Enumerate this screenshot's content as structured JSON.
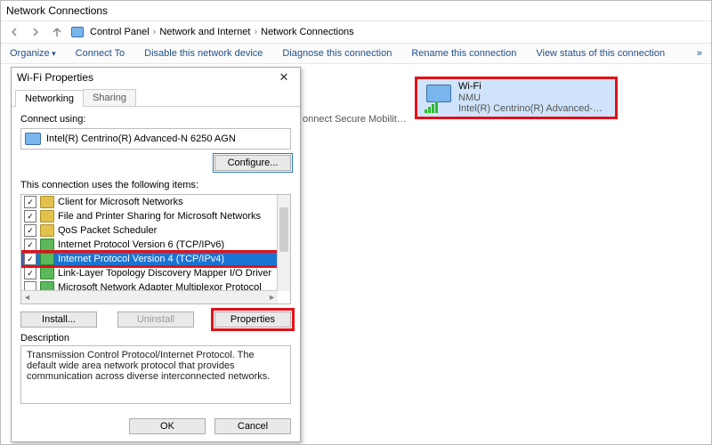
{
  "window": {
    "title": "Network Connections"
  },
  "breadcrumb": [
    "Control Panel",
    "Network and Internet",
    "Network Connections"
  ],
  "toolbar": {
    "organize": "Organize",
    "connect_to": "Connect To",
    "disable": "Disable this network device",
    "diagnose": "Diagnose this connection",
    "rename": "Rename this connection",
    "view_status": "View status of this connection",
    "overflow": "»"
  },
  "background_peek": "onnect Secure Mobilit…",
  "connection": {
    "name": "Wi-Fi",
    "ssid": "NMU",
    "adapter_short": "Intel(R) Centrino(R) Advanced-N ..."
  },
  "dialog": {
    "title": "Wi-Fi Properties",
    "tabs": [
      "Networking",
      "Sharing"
    ],
    "connect_using_label": "Connect using:",
    "adapter": "Intel(R) Centrino(R) Advanced-N 6250 AGN",
    "configure": "Configure...",
    "items_label": "This connection uses the following items:",
    "items": [
      {
        "label": "Client for Microsoft Networks",
        "checked": true
      },
      {
        "label": "File and Printer Sharing for Microsoft Networks",
        "checked": true
      },
      {
        "label": "QoS Packet Scheduler",
        "checked": true
      },
      {
        "label": "Internet Protocol Version 6 (TCP/IPv6)",
        "checked": true
      },
      {
        "label": "Internet Protocol Version 4 (TCP/IPv4)",
        "checked": true,
        "selected": true
      },
      {
        "label": "Link-Layer Topology Discovery Mapper I/O Driver",
        "checked": true
      },
      {
        "label": "Microsoft Network Adapter Multiplexor Protocol",
        "checked": false
      }
    ],
    "install": "Install...",
    "uninstall": "Uninstall",
    "properties": "Properties",
    "description_label": "Description",
    "description": "Transmission Control Protocol/Internet Protocol. The default wide area network protocol that provides communication across diverse interconnected networks.",
    "ok": "OK",
    "cancel": "Cancel"
  },
  "highlight_color": "#e1111a"
}
